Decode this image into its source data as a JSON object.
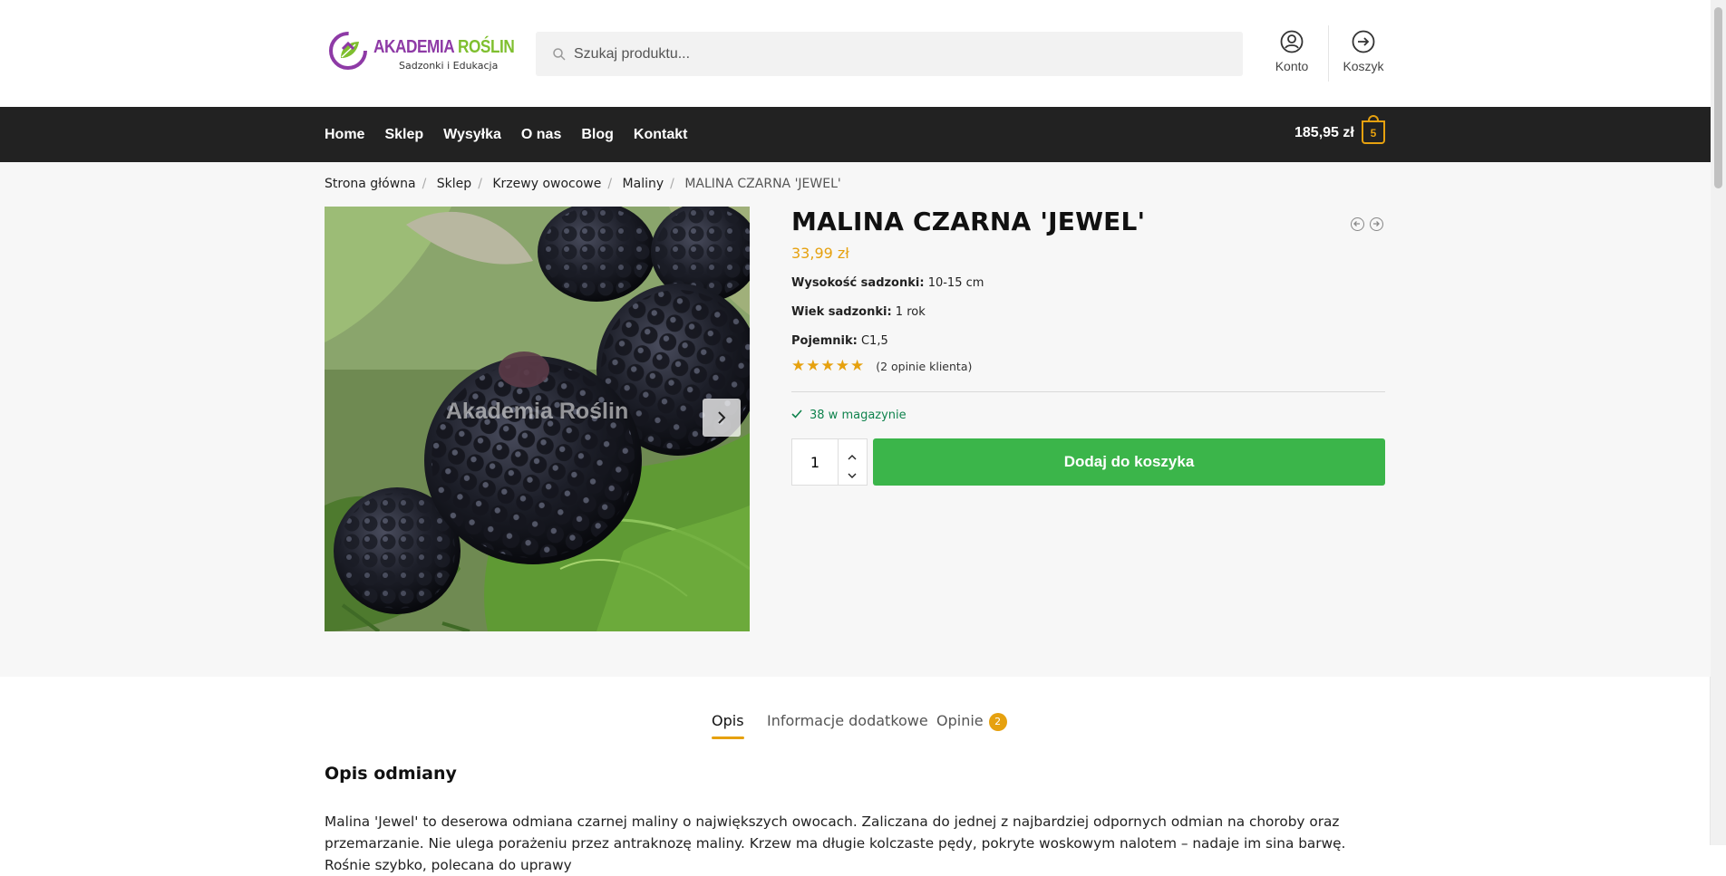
{
  "header": {
    "logo": {
      "brand_part1": "AKADEMIA ",
      "brand_part2": "ROŚLIN",
      "tagline": "Sadzonki i Edukacja"
    },
    "search": {
      "placeholder": "Szukaj produktu..."
    },
    "account_label": "Konto",
    "cart_label": "Koszyk"
  },
  "nav": {
    "items": [
      "Home",
      "Sklep",
      "Wysyłka",
      "O nas",
      "Blog",
      "Kontakt"
    ],
    "cart_total": "185,95 zł",
    "cart_count": "5"
  },
  "breadcrumb": [
    "Strona główna",
    "Sklep",
    "Krzewy owocowe",
    "Maliny",
    "MALINA CZARNA 'JEWEL'"
  ],
  "gallery": {
    "watermark": "Akademia Roślin"
  },
  "product": {
    "title": "MALINA CZARNA 'JEWEL'",
    "price": "33,99 zł",
    "attributes": [
      {
        "label": "Wysokość sadzonki:",
        "value": "10-15 cm"
      },
      {
        "label": "Wiek sadzonki:",
        "value": "1 rok"
      },
      {
        "label": "Pojemnik:",
        "value": "C1,5"
      }
    ],
    "rating_stars": 5,
    "reviews_text": "(2 opinie klienta)",
    "stock": "38 w magazynie",
    "quantity": "1",
    "add_to_cart": "Dodaj do koszyka"
  },
  "tabs": [
    {
      "label": "Opis"
    },
    {
      "label": "Informacje dodatkowe"
    },
    {
      "label": "Opinie",
      "badge": "2"
    }
  ],
  "description": {
    "heading": "Opis odmiany",
    "text": "Malina 'Jewel' to deserowa odmiana czarnej maliny o największych owocach. Zaliczana do jednej z najbardziej odpornych odmian na choroby oraz przemarzanie. Nie ulega porażeniu przez antraknozę maliny. Krzew ma długie kolczaste pędy, pokryte woskowym nalotem – nadaje im sina barwę. Rośnie szybko, polecana do uprawy"
  },
  "colors": {
    "accent": "#e6a10f",
    "nav_bg": "#222222",
    "button_green": "#3bb54a",
    "stock_green": "#0f834d"
  }
}
